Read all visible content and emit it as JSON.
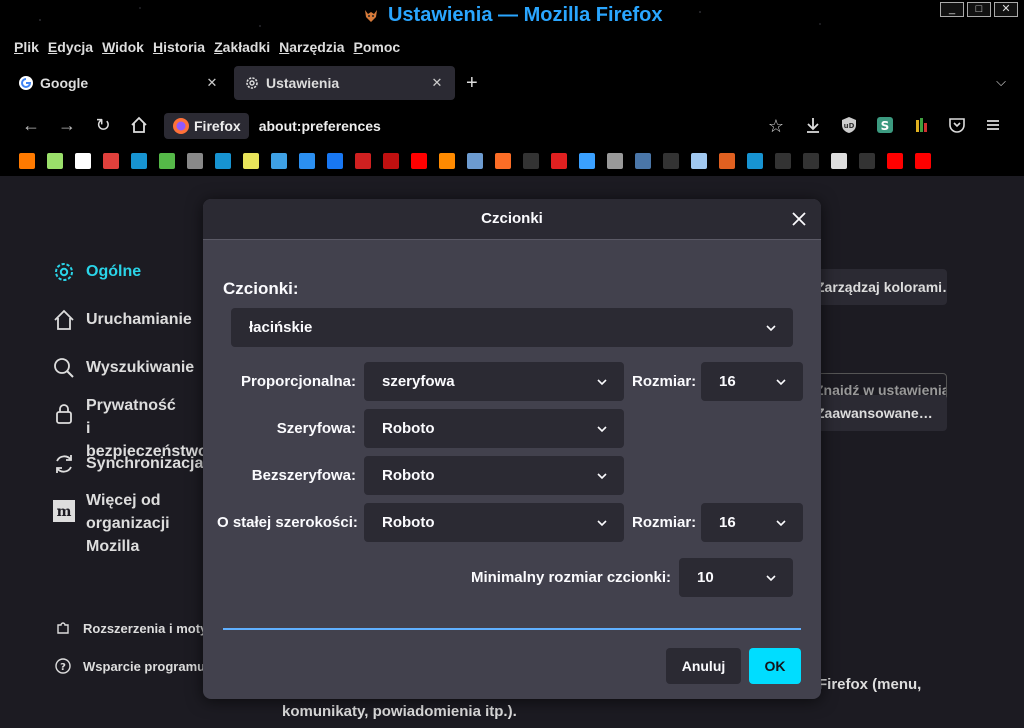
{
  "window": {
    "title": "Ustawienia — Mozilla Firefox",
    "controls": [
      "_",
      "□",
      "✕"
    ]
  },
  "menubar": [
    "Plik",
    "Edycja",
    "Widok",
    "Historia",
    "Zakładki",
    "Narzędzia",
    "Pomoc"
  ],
  "tabs": [
    {
      "label": "Google",
      "icon": "google-icon",
      "active": false
    },
    {
      "label": "Ustawienia",
      "icon": "gear-icon",
      "active": true
    }
  ],
  "newtab_label": "+",
  "tablist_label": "⌵",
  "navbar": {
    "identity_label": "Firefox",
    "url": "about:preferences"
  },
  "bookmarks": [
    {
      "icon": "orange-square-icon",
      "color": "#ff7a00"
    },
    {
      "icon": "octocat-icon",
      "color": "#9adf6a"
    },
    {
      "icon": "ghost-icon",
      "color": "#ffffff"
    },
    {
      "icon": "arch-red-icon",
      "color": "#e0403c"
    },
    {
      "icon": "arch-icon",
      "color": "#1793d1"
    },
    {
      "icon": "green-box-icon",
      "color": "#55b848"
    },
    {
      "icon": "gimp-icon",
      "color": "#888888"
    },
    {
      "icon": "arch-icon",
      "color": "#1793d1"
    },
    {
      "icon": "dw-icon",
      "color": "#e8e45a"
    },
    {
      "icon": "html5-icon",
      "color": "#3ea0e4"
    },
    {
      "icon": "p-icon",
      "color": "#2b8ff0"
    },
    {
      "icon": "facebook-icon",
      "color": "#1877f2"
    },
    {
      "icon": "e-icon",
      "color": "#d02020"
    },
    {
      "icon": "red-text-icon",
      "color": "#c01010"
    },
    {
      "icon": "youtube-icon",
      "color": "#ff0000"
    },
    {
      "icon": "p-orange-icon",
      "color": "#ff8a00"
    },
    {
      "icon": "eye-icon",
      "color": "#6c9bd0"
    },
    {
      "icon": "gitlab-icon",
      "color": "#fc6d26"
    },
    {
      "icon": "github-icon",
      "color": "#333333"
    },
    {
      "icon": "m-red-icon",
      "color": "#e02020"
    },
    {
      "icon": "swift-icon",
      "color": "#3aa0ff"
    },
    {
      "icon": "dolphin-icon",
      "color": "#999999"
    },
    {
      "icon": "vk-icon",
      "color": "#4a76a8"
    },
    {
      "icon": "github-icon",
      "color": "#333333"
    },
    {
      "icon": "cube-icon",
      "color": "#a0c8f0"
    },
    {
      "icon": "orange-box-icon",
      "color": "#e06020"
    },
    {
      "icon": "arch-icon",
      "color": "#1793d1"
    },
    {
      "icon": "github-icon",
      "color": "#333333"
    },
    {
      "icon": "github-icon",
      "color": "#333333"
    },
    {
      "icon": "binary-icon",
      "color": "#dddddd"
    },
    {
      "icon": "github-icon",
      "color": "#333333"
    },
    {
      "icon": "youtube-icon",
      "color": "#ff0000"
    },
    {
      "icon": "youtube-icon",
      "color": "#ff0000"
    }
  ],
  "sidebar": {
    "items": [
      {
        "label": "Ogólne",
        "icon": "gear-icon",
        "selected": true
      },
      {
        "label": "Uruchamianie",
        "icon": "home-icon",
        "selected": false
      },
      {
        "label": "Wyszukiwanie",
        "icon": "search-icon",
        "selected": false
      },
      {
        "label": "Prywatność\ni bezpieczeństwo",
        "icon": "lock-icon",
        "selected": false
      },
      {
        "label": "Synchronizacja",
        "icon": "sync-icon",
        "selected": false
      },
      {
        "label": "Więcej od\norganizacji Mozilla",
        "icon": "mozilla-icon",
        "selected": false
      }
    ],
    "bottom": [
      {
        "label": "Rozszerzenia i motywy",
        "icon": "puzzle-icon"
      },
      {
        "label": "Wsparcie programu Firefox",
        "icon": "help-icon"
      }
    ]
  },
  "background": {
    "find_placeholder": "Znajdź w ustawieniach",
    "manage_colors_label": "Zarządzaj kolorami…",
    "advanced_label": "Zaawansowane…",
    "text_line1": "Firefox (menu,",
    "text_line2": "komunikaty, powiadomienia itp.)."
  },
  "dialog": {
    "title": "Czcionki",
    "section_title": "Czcionki:",
    "script_select": "łacińskie",
    "rows": [
      {
        "label": "Proporcjonalna:",
        "value": "szeryfowa",
        "size_label": "Rozmiar:",
        "size_value": "16"
      },
      {
        "label": "Szeryfowa:",
        "value": "Roboto"
      },
      {
        "label": "Bezszeryfowa:",
        "value": "Roboto"
      },
      {
        "label": "O stałej szerokości:",
        "value": "Roboto",
        "size_label": "Rozmiar:",
        "size_value": "16"
      }
    ],
    "min_size_label": "Minimalny rozmiar czcionki:",
    "min_size_value": "10",
    "cancel_label": "Anuluj",
    "ok_label": "OK"
  },
  "colors": {
    "accent": "#00ddff",
    "selected_nav": "#2ad4e8",
    "title_text": "#2aa6ff"
  }
}
